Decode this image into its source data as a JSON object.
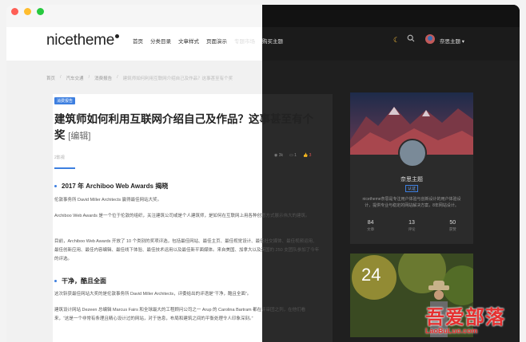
{
  "window": {
    "controls": [
      "close",
      "minimize",
      "maximize"
    ]
  },
  "header": {
    "logo": "nicetheme",
    "nav": [
      "首页",
      "分类目录",
      "文章样式",
      "页面演示",
      "专题市场",
      "购买主题"
    ],
    "user_name": "奈思主题 ▾"
  },
  "breadcrumb": [
    "首页",
    "汽车交通",
    "消费报告",
    "建筑师如何利用互联网介绍自己及作品？这事甚至有个奖"
  ],
  "article": {
    "badge": "消费报告",
    "title": "建筑师如何利用互联网介绍自己及作品？这事甚至有个奖",
    "edit_label": "[编辑]",
    "author": "2影视",
    "views": "3k",
    "comments": "1",
    "likes": "3",
    "sections": [
      {
        "heading": "2017 年 Archiboo Web Awards 揭晓"
      },
      {
        "heading": "干净，酷且全面"
      }
    ],
    "paragraphs": [
      "伦敦事务所 David Miller Architects 赢得最佳网站大奖。",
      "Archiboo Web Awards 是一个位于伦敦的组织，关注建筑公司或是个人建筑师，是如何在互联网上用各种创意方式展示伟大的建筑。",
      "目前，Archiboo Web Awards 开放了 10 个类别的奖项评选，包括最佳网站、最佳主页、最佳视觉设计、最佳社交媒体、最佳视频运用、最佳创新应用、最佳内容编辑、最佳线下体验、最佳技术运用以及最佳新平面媒体。来自美国、加拿大以及英国的 250 支团队参加了今年的评选。",
      "这次斩获最佳网站大奖的是伦敦事务所 David Miller Architects，评委给出的评语是“干净，酷且全面”。",
      "建筑设计网站 Dezeen 总编辑 Marcus Fairs 和全球最大的工程顾问公司之一 Arup 的 Carolina Bartram 都在评审团之列，在他们看来，“这是一个非常有条理且精心设计过的网站，对于信息，布局和建筑之间的平衡处理令人印象深刻。”"
    ]
  },
  "sidebar": {
    "profile": {
      "name": "奈思主题",
      "tag": "认证",
      "description": "nicetheme奈思是专注用户体验与创新设计的用户体验设计，提供专业与稳定的网站解决方案，8年网站设计。",
      "stats": [
        {
          "num": "84",
          "label": "文章"
        },
        {
          "num": "13",
          "label": "评论"
        },
        {
          "num": "50",
          "label": "获赞"
        }
      ]
    },
    "photo_card": {
      "number": "24"
    }
  },
  "watermark": {
    "cn": "吾爱部落",
    "en": "LaoBuLuo.com"
  },
  "colors": {
    "accent": "#3d7fe0",
    "dark_bg": "#1f1f1f",
    "light_bg": "#f1f1f1",
    "watermark": "#e53030"
  }
}
